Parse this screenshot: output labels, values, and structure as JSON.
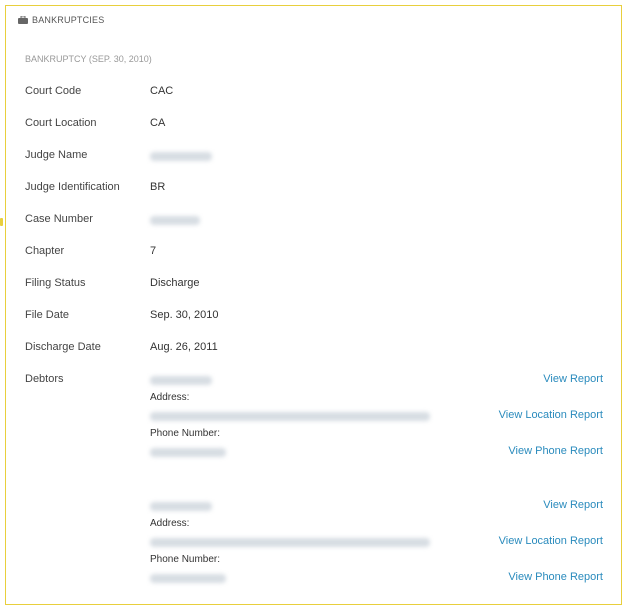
{
  "section": {
    "title": "BANKRUPTCIES",
    "icon": "briefcase-icon",
    "accent": "#e8cf3d"
  },
  "record": {
    "subtitle": "BANKRUPTCY (SEP. 30, 2010)",
    "fields": [
      {
        "label": "Court Code",
        "value": "CAC"
      },
      {
        "label": "Court Location",
        "value": "CA"
      },
      {
        "label": "Judge Name",
        "value": ""
      },
      {
        "label": "Judge Identification",
        "value": "BR"
      },
      {
        "label": "Case Number",
        "value": ""
      },
      {
        "label": "Chapter",
        "value": "7"
      },
      {
        "label": "Filing Status",
        "value": "Discharge"
      },
      {
        "label": "File Date",
        "value": "Sep. 30, 2010"
      },
      {
        "label": "Discharge Date",
        "value": "Aug. 26, 2011"
      }
    ],
    "debtors_label": "Debtors",
    "debtors": [
      {
        "address_label": "Address:",
        "phone_label": "Phone Number:",
        "view_report": "View Report",
        "view_location_report": "View Location Report",
        "view_phone_report": "View Phone Report"
      },
      {
        "address_label": "Address:",
        "phone_label": "Phone Number:",
        "view_report": "View Report",
        "view_location_report": "View Location Report",
        "view_phone_report": "View Phone Report"
      }
    ]
  },
  "colors": {
    "link": "#2a8bbd",
    "border": "#e8cf3d"
  }
}
